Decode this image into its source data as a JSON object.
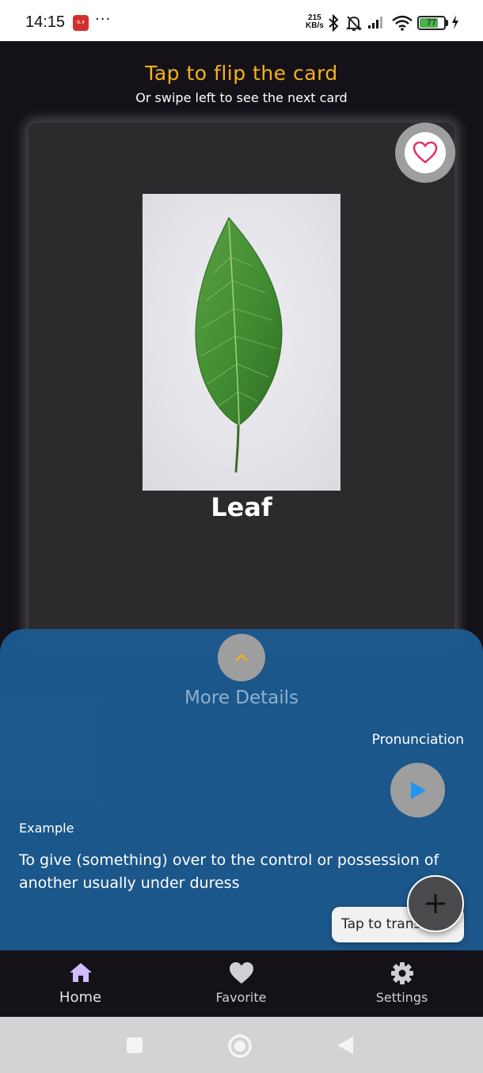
{
  "status_bar": {
    "time": "14:15",
    "notification_app": "6.4",
    "dots": "···",
    "net_speed_value": "215",
    "net_speed_unit": "KB/s",
    "battery_level": 77
  },
  "header": {
    "title": "Tap to flip the card",
    "subtitle": "Or swipe left to see the next card"
  },
  "card": {
    "word": "Leaf",
    "image_icon": "leaf-image",
    "favorite_icon": "heart-outline-icon"
  },
  "details": {
    "more_details_label": "More Details",
    "pronunciation_label": "Pronunciation",
    "example_label": "Example",
    "example_text": "To give (something) over to the control or possession of another usually under duress"
  },
  "tooltip": {
    "text": "Tap to translate"
  },
  "bottom_nav": {
    "items": [
      {
        "label": "Home",
        "icon": "home-icon",
        "active": true
      },
      {
        "label": "Favorite",
        "icon": "heart-icon",
        "active": false
      },
      {
        "label": "Settings",
        "icon": "gear-icon",
        "active": false
      }
    ]
  },
  "colors": {
    "accent": "#f5b21a",
    "sheet": "#1d5a8f",
    "favorite": "#e0356c",
    "play": "#2196f3",
    "nav_active": "#d0bcff"
  }
}
